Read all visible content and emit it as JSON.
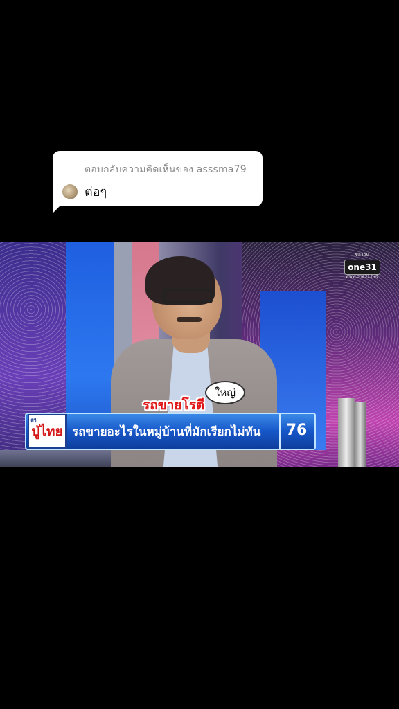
{
  "reply": {
    "label": "ตอบกลับความคิดเห็นของ asssma79",
    "text": "ต่อๆ"
  },
  "video": {
    "channel_logo": "one31",
    "channel_top": "ช่องวัน",
    "channel_url": "www.one31.net",
    "show_logo_small": "ทีวี",
    "show_logo": "ปู่ไทย",
    "name_tag": "ใหญ่",
    "answer": "รถขายโรตี",
    "question": "รถขายอะไรในหมู่บ้านที่มักเรียกไม่ทัน",
    "score": "76"
  },
  "colors": {
    "answer_red": "#e01818",
    "bar_blue": "#1656c8"
  }
}
